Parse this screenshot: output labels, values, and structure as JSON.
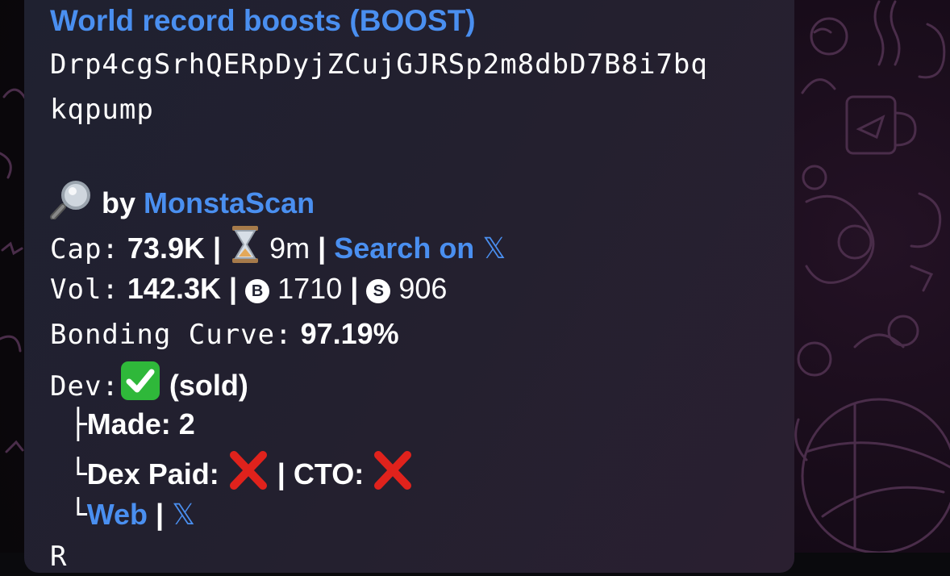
{
  "message": {
    "title": "World record boosts (BOOST)",
    "address_line1": "Drp4cgSrhQERpDyjZCujGJRSp2m8dbD7B8i7bq",
    "address_line2": "kqpump",
    "by_label": "by",
    "scanner_name": "MonstaScan",
    "cap_label": "Cap:",
    "cap_value": "73.9K",
    "age_value": "9m",
    "search_label": "Search on",
    "x_glyph": "𝕏",
    "vol_label": "Vol:",
    "vol_value": "142.3K",
    "buys_badge": "B",
    "buys_value": "1710",
    "sells_badge": "S",
    "sells_value": "906",
    "bonding_label": "Bonding Curve:",
    "bonding_value": "97.19%",
    "dev_label": "Dev:",
    "dev_status": "(sold)",
    "made_label": "Made:",
    "made_value": "2",
    "dex_label": "Dex Paid:",
    "cto_label": "CTO:",
    "web_label": "Web",
    "separator": "|",
    "tree_branch": "├",
    "tree_end": "└",
    "partial_next": "R"
  },
  "icons": {
    "magnifier": "magnifier-icon",
    "hourglass": "hourglass-icon",
    "check": "check-mark-icon",
    "cross": "cross-mark-icon"
  },
  "colors": {
    "link": "#4a8ff0",
    "check_green": "#2fb83a",
    "cross_red": "#e0221c"
  }
}
